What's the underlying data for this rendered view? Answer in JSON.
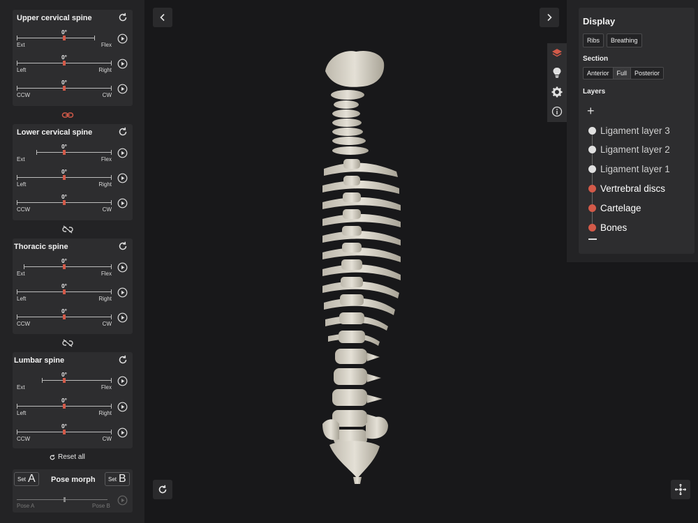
{
  "left_panel": {
    "sections": [
      {
        "title": "Upper cervical spine",
        "sliders": [
          {
            "value": "0°",
            "left": "Ext",
            "right": "Flex"
          },
          {
            "value": "0°",
            "left": "Left",
            "right": "Right"
          },
          {
            "value": "0°",
            "left": "CCW",
            "right": "CW"
          }
        ]
      },
      {
        "title": "Lower cervical spine",
        "sliders": [
          {
            "value": "0°",
            "left": "Ext",
            "right": "Flex"
          },
          {
            "value": "0°",
            "left": "Left",
            "right": "Right"
          },
          {
            "value": "0°",
            "left": "CCW",
            "right": "CW"
          }
        ]
      },
      {
        "title": "Thoracic spine",
        "sliders": [
          {
            "value": "0°",
            "left": "Ext",
            "right": "Flex"
          },
          {
            "value": "0°",
            "left": "Left",
            "right": "Right"
          },
          {
            "value": "0°",
            "left": "CCW",
            "right": "CW"
          }
        ]
      },
      {
        "title": "Lumbar spine",
        "sliders": [
          {
            "value": "0°",
            "left": "Ext",
            "right": "Flex"
          },
          {
            "value": "0°",
            "left": "Left",
            "right": "Right"
          },
          {
            "value": "0°",
            "left": "CCW",
            "right": "CW"
          }
        ]
      }
    ],
    "reset_all": "Reset all",
    "pose": {
      "set_a_label": "Set",
      "set_a_letter": "A",
      "title": "Pose morph",
      "set_b_label": "Set",
      "set_b_letter": "B",
      "pose_a": "Pose A",
      "pose_b": "Pose B"
    }
  },
  "right_panel": {
    "title": "Display",
    "chips": [
      "Ribs",
      "Breathing"
    ],
    "section_label": "Section",
    "section_options": [
      "Anterior",
      "Full",
      "Posterior"
    ],
    "section_selected": "Full",
    "layers_label": "Layers",
    "layers": [
      {
        "name": "Ligament layer 3",
        "active": false
      },
      {
        "name": "Ligament layer 2",
        "active": false
      },
      {
        "name": "Ligament layer 1",
        "active": false
      },
      {
        "name": "Vertrebral discs",
        "active": true
      },
      {
        "name": "Cartelage",
        "active": true
      },
      {
        "name": "Bones",
        "active": true
      }
    ]
  },
  "colors": {
    "accent": "#d35a49",
    "inactive_dot": "#e0e0e0"
  }
}
